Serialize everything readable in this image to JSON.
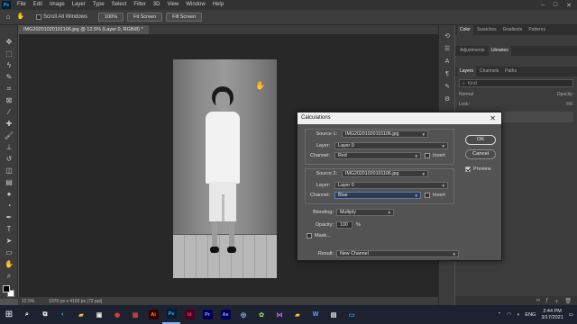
{
  "menubar": {
    "logo": "Ps",
    "items": [
      "File",
      "Edit",
      "Image",
      "Layer",
      "Type",
      "Select",
      "Filter",
      "3D",
      "View",
      "Window",
      "Help"
    ],
    "window_controls": [
      "–",
      "□",
      "✕"
    ]
  },
  "options_bar": {
    "scroll_all_windows": "Scroll All Windows",
    "zoom_btn": "100%",
    "fit_btn": "Fit Screen",
    "fill_btn": "Fill Screen"
  },
  "document": {
    "tab_title": "IMG20201020101106.jpg @ 12.5% (Layer 0, RGB/8) *"
  },
  "status_bar": {
    "zoom": "12.5%",
    "size": "1970 px x 4160 px (72 ppi)"
  },
  "panels": {
    "top_tabs": [
      "Color",
      "Swatches",
      "Gradients",
      "Patterns"
    ],
    "mid_tabs": [
      "Adjustments",
      "Libraries"
    ],
    "layer_tabs": [
      "Layers",
      "Channels",
      "Paths"
    ],
    "search_placeholder": "Kind",
    "blend_mode": "Normal",
    "opacity_label": "Opacity:",
    "lock_label": "Lock:",
    "fill_label": "Fill:"
  },
  "dialog": {
    "title": "Calculations",
    "source1_label": "Source 1:",
    "source1_value": "IMG20201020101106.jpg",
    "layer1_label": "Layer:",
    "layer1_value": "Layer 0",
    "channel1_label": "Channel:",
    "channel1_value": "Red",
    "invert1_label": "Invert",
    "source2_label": "Source 2:",
    "source2_value": "IMG20201020101106.jpg",
    "layer2_label": "Layer:",
    "layer2_value": "Layer 0",
    "channel2_label": "Channel:",
    "channel2_value": "Blue",
    "invert2_label": "Invert",
    "blending_label": "Blending:",
    "blending_value": "Multiply",
    "opacity_label": "Opacity:",
    "opacity_value": "100",
    "opacity_unit": "%",
    "mask_label": "Mask...",
    "result_label": "Result:",
    "result_value": "New Channel",
    "ok_label": "OK",
    "cancel_label": "Cancel",
    "preview_label": "Preview",
    "preview_checked": true
  },
  "taskbar": {
    "apps": [
      {
        "name": "Ai",
        "color": "#ff9a00",
        "bg": "#330000"
      },
      {
        "name": "Ps",
        "color": "#31a8ff",
        "bg": "#001e36"
      },
      {
        "name": "Id",
        "color": "#ff3366",
        "bg": "#49021f"
      },
      {
        "name": "Pr",
        "color": "#9999ff",
        "bg": "#00005b"
      },
      {
        "name": "Ae",
        "color": "#9999ff",
        "bg": "#00005b"
      }
    ],
    "language": "ENG",
    "time": "2:44 PM",
    "date": "3/17/2021"
  }
}
